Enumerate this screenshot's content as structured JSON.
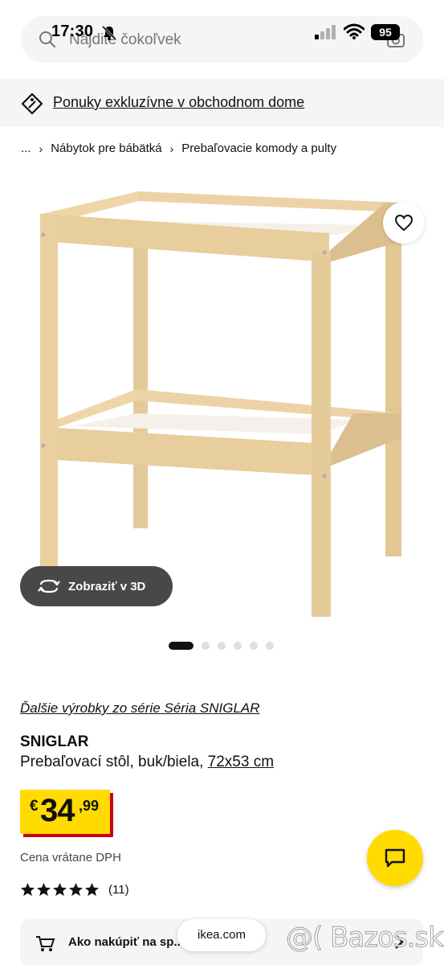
{
  "status_bar": {
    "time": "17:30",
    "battery": "95"
  },
  "search": {
    "placeholder": "Nájdite čokoľvek"
  },
  "promo": {
    "text": "Ponuky exkluzívne v obchodnom dome"
  },
  "breadcrumb": {
    "ellipsis": "...",
    "items": [
      "Nábytok pre bábätká",
      "Prebaľovacie komody a pulty"
    ]
  },
  "gallery": {
    "view_3d_label": "Zobraziť v 3D",
    "total_images": 6,
    "active_index": 0
  },
  "product": {
    "series_link": "Ďalšie výrobky zo série Séria SNIGLAR",
    "name": "SNIGLAR",
    "description": "Prebaľovací stôl, buk/biela,",
    "dimensions": "72x53 cm",
    "price": {
      "currency": "€",
      "integer": "34",
      "cents": ",99"
    },
    "vat_note": "Cena vrátane DPH",
    "rating": {
      "stars": 5,
      "count": "(11)"
    }
  },
  "howto": {
    "label": "Ako nakúpiť na sp..."
  },
  "browser": {
    "url": "ikea.com"
  },
  "watermark": "@( Bazos.sk",
  "colors": {
    "brand_yellow": "#ffdb00",
    "price_shadow": "#cc0008",
    "dark_pill": "#484848",
    "light_bg": "#f5f5f5",
    "wood": "#e6cc9e"
  },
  "icons": [
    "search-icon",
    "camera-icon",
    "bell-off-icon",
    "signal-icon",
    "wifi-icon",
    "tag-icon",
    "heart-icon",
    "rotate-3d-icon",
    "star-icon",
    "chat-icon",
    "cart-icon",
    "chevron-right-icon"
  ]
}
